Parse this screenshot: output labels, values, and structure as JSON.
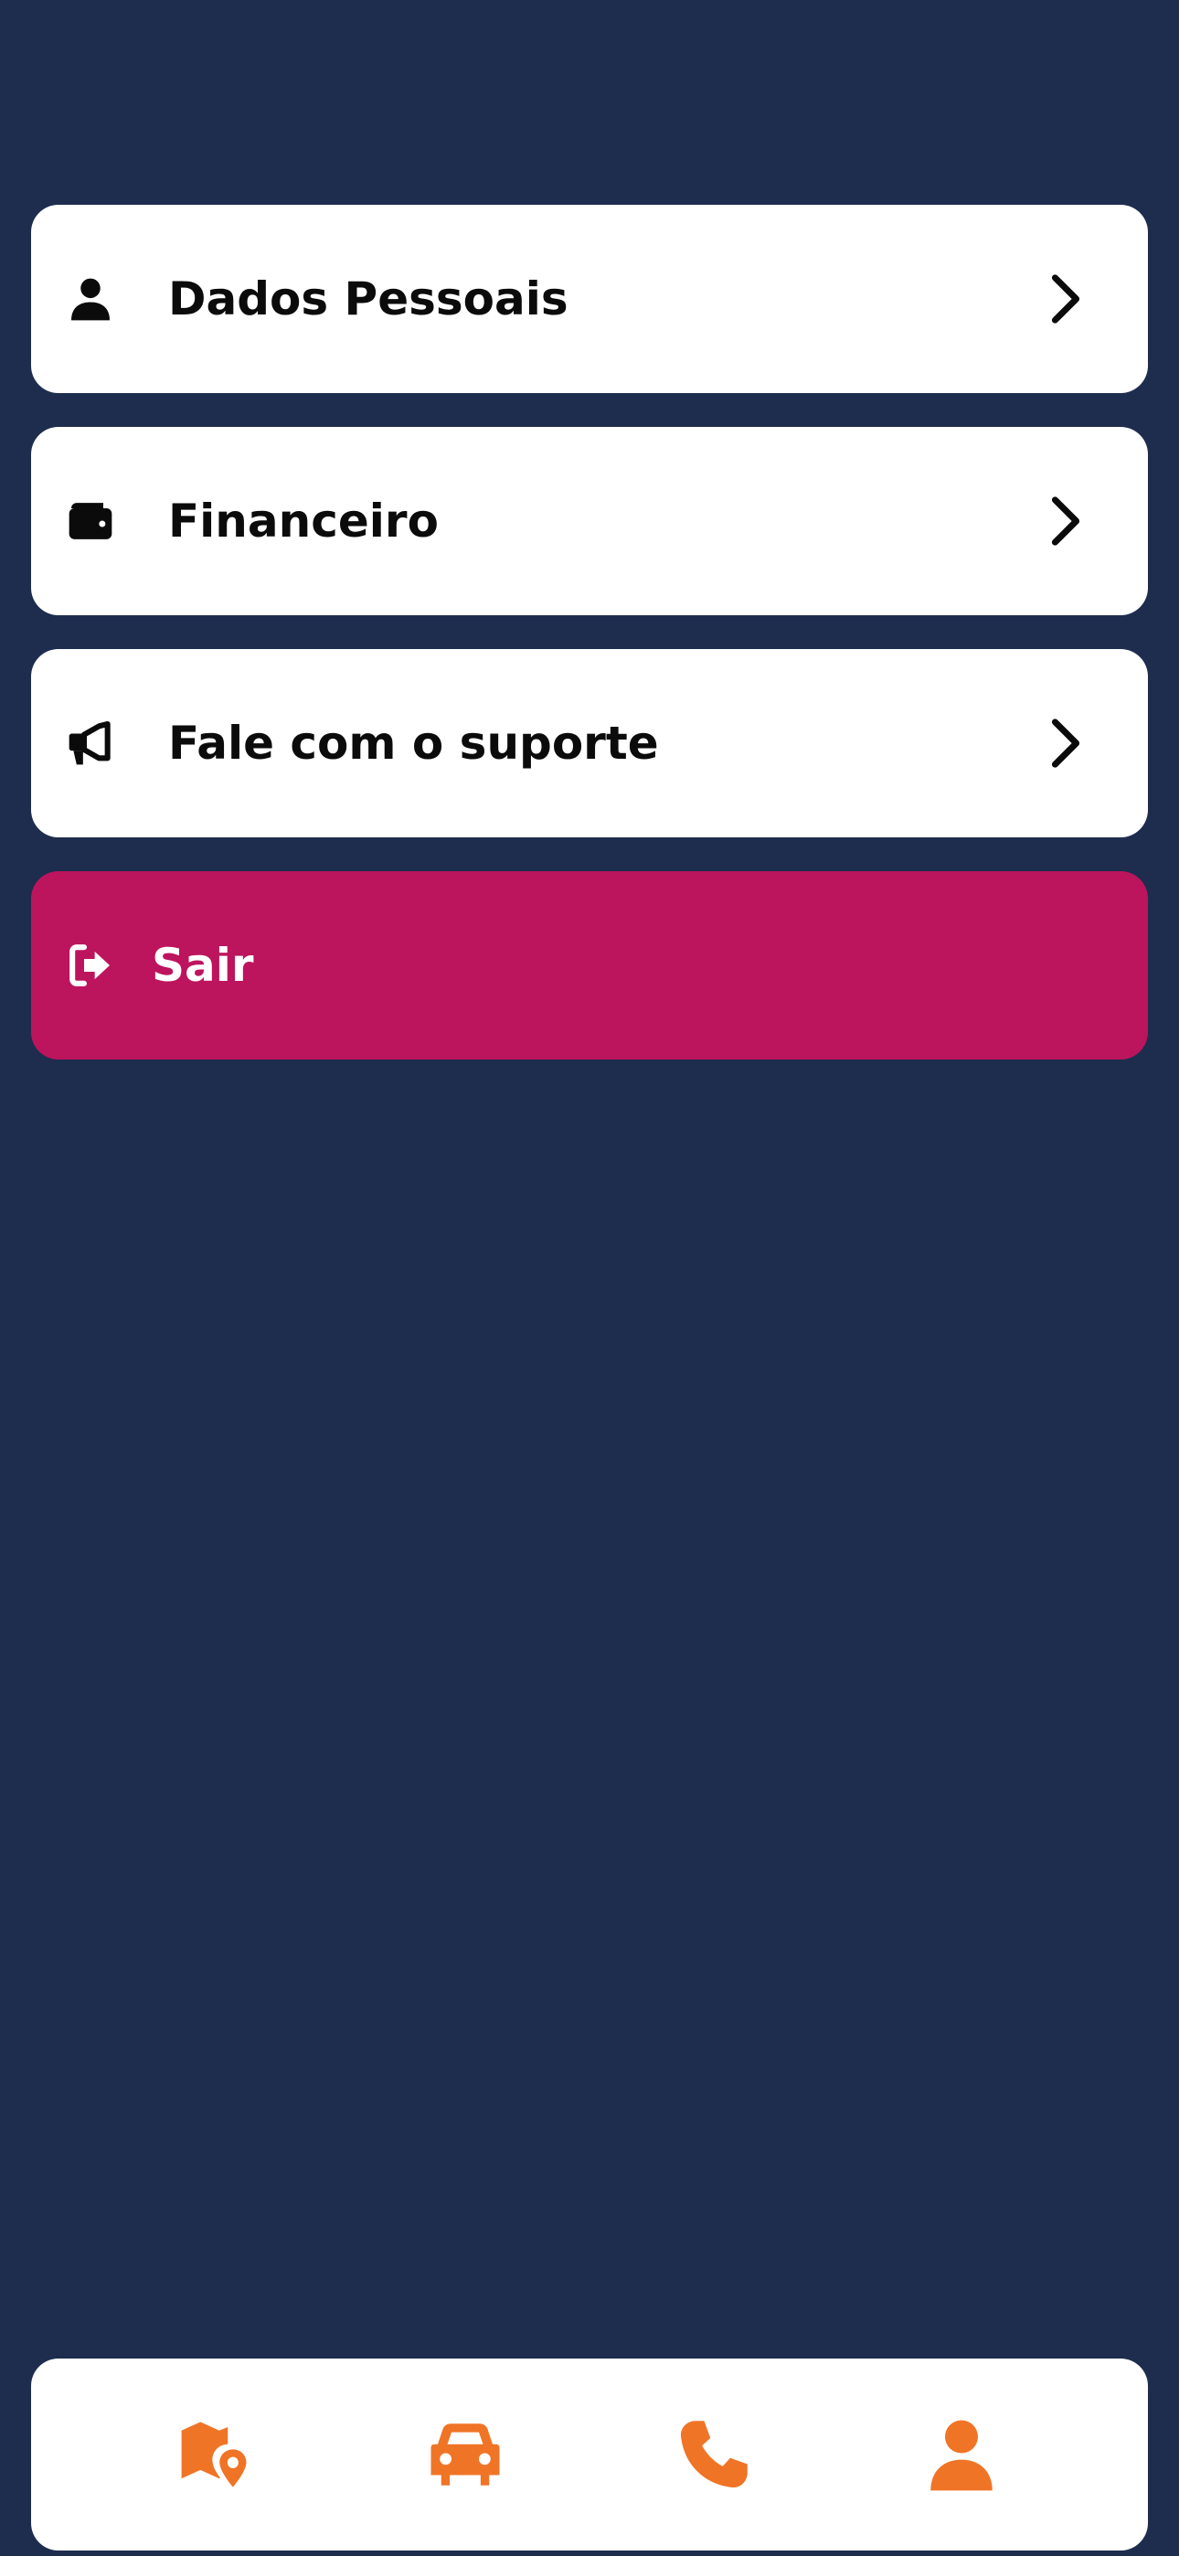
{
  "menu": {
    "items": [
      {
        "label": "Dados Pessoais",
        "icon": "user-icon"
      },
      {
        "label": "Financeiro",
        "icon": "wallet-icon"
      },
      {
        "label": "Fale com o suporte",
        "icon": "megaphone-icon"
      }
    ],
    "logout": {
      "label": "Sair",
      "icon": "logout-icon"
    }
  },
  "bottom_nav": {
    "items": [
      {
        "icon": "map-location-icon"
      },
      {
        "icon": "car-icon"
      },
      {
        "icon": "phone-icon"
      },
      {
        "icon": "user-icon"
      }
    ]
  },
  "colors": {
    "background": "#1e2d4e",
    "card": "#ffffff",
    "logout": "#bd145e",
    "nav_icon": "#f07426"
  }
}
